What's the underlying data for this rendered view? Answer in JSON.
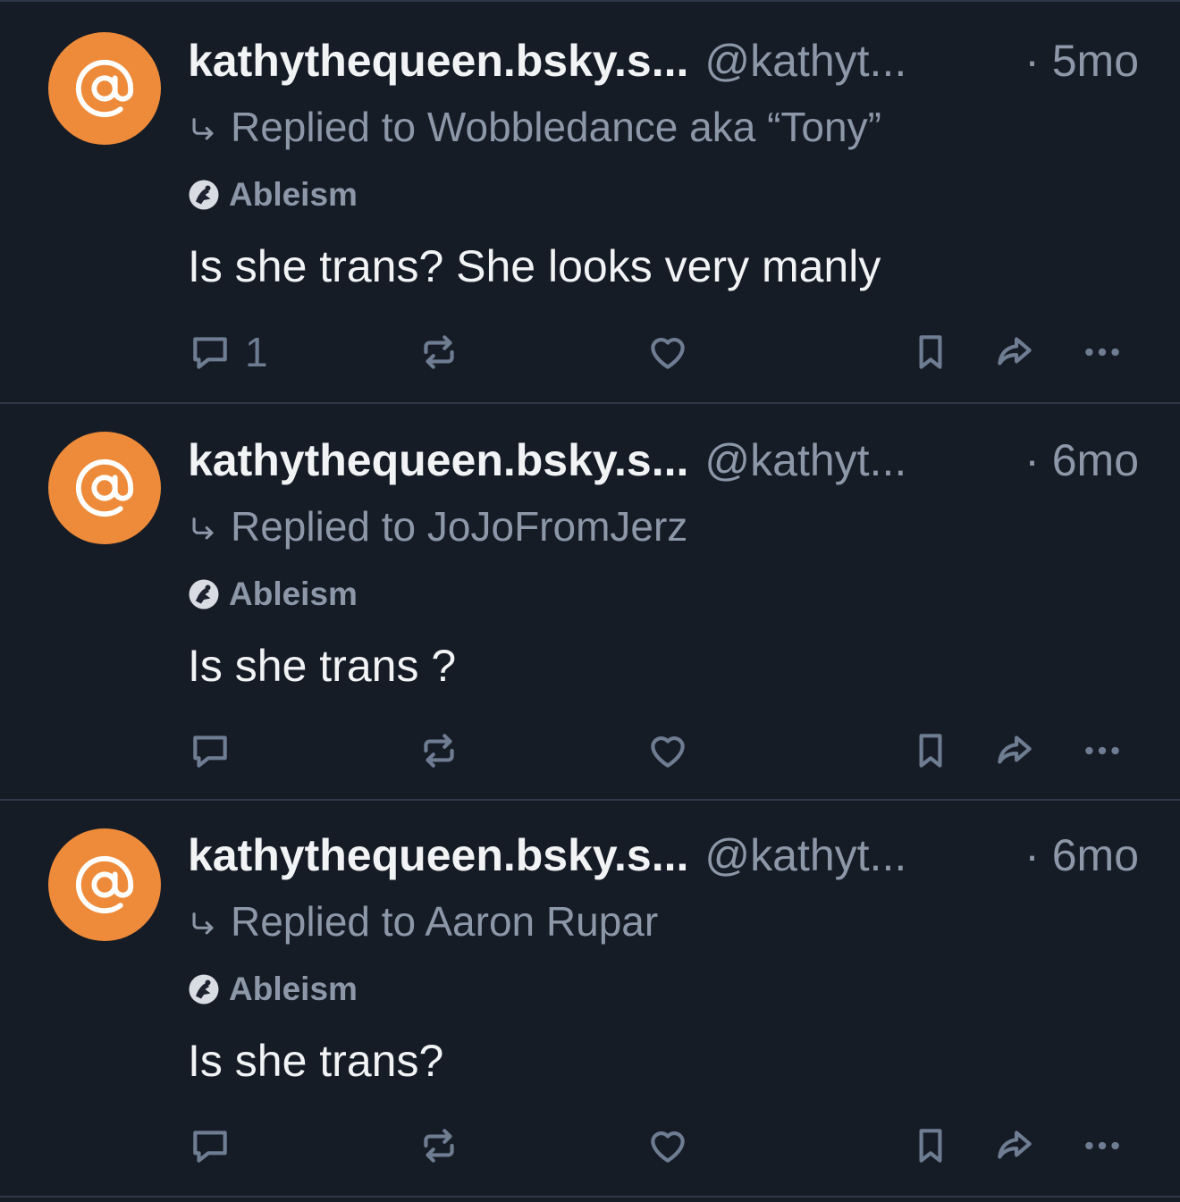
{
  "colors": {
    "background": "#161c26",
    "divider": "#2e3848",
    "avatar": "#ee8b3a",
    "muted_text": "#8c97a8",
    "icon": "#6f7d92",
    "primary_text": "#f1f3f5"
  },
  "posts": [
    {
      "display_name": "kathythequeen.bsky.s...",
      "handle": "@kathyt...",
      "time": "· 5mo",
      "reply_to": "Replied to Wobbledance aka “Tony”",
      "label": "Ableism",
      "text": "Is she trans? She looks very manly",
      "reply_count": "1"
    },
    {
      "display_name": "kathythequeen.bsky.s...",
      "handle": "@kathyt...",
      "time": "· 6mo",
      "reply_to": "Replied to JoJoFromJerz",
      "label": "Ableism",
      "text": "Is she trans ?",
      "reply_count": ""
    },
    {
      "display_name": "kathythequeen.bsky.s...",
      "handle": "@kathyt...",
      "time": "· 6mo",
      "reply_to": "Replied to Aaron Rupar",
      "label": "Ableism",
      "text": "Is she trans?",
      "reply_count": ""
    }
  ]
}
